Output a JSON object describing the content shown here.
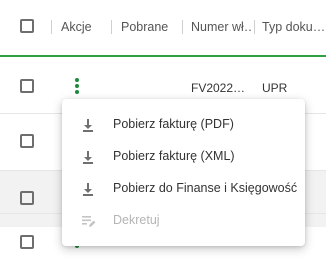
{
  "header": {
    "columns": [
      "Akcje",
      "Pobrane",
      "Numer wł…",
      "Typ doku…"
    ]
  },
  "rows": [
    {
      "number": "FV2022…",
      "type": "UPR"
    }
  ],
  "menu": {
    "items": [
      {
        "label": "Pobierz fakturę (PDF)",
        "icon": "download-icon",
        "disabled": false
      },
      {
        "label": "Pobierz fakturę (XML)",
        "icon": "download-icon",
        "disabled": false
      },
      {
        "label": "Pobierz do Finanse i Księgowość",
        "icon": "download-icon",
        "disabled": false
      },
      {
        "label": "Dekretuj",
        "icon": "edit-list-icon",
        "disabled": true
      }
    ]
  },
  "colors": {
    "accent": "#1e8a3c",
    "header_underline": "#2ea043",
    "alt_row": "#f2f2f2"
  }
}
